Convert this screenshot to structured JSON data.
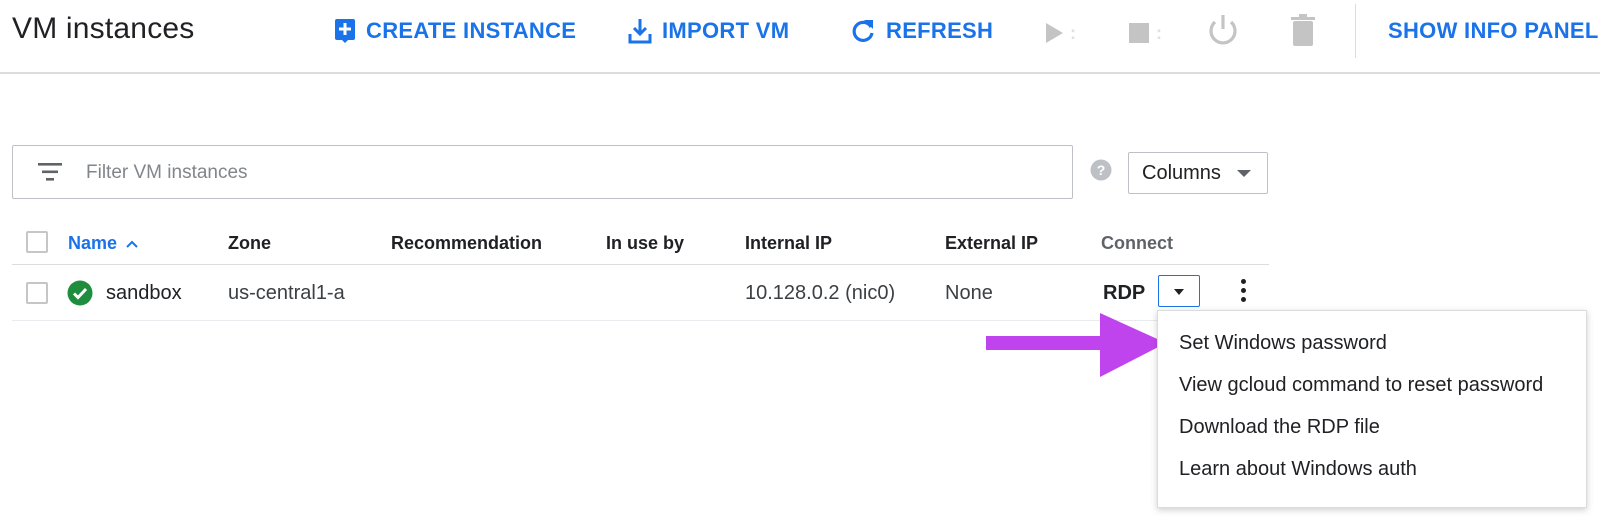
{
  "header": {
    "title": "VM instances",
    "create_instance": "CREATE INSTANCE",
    "import_vm": "IMPORT VM",
    "refresh": "REFRESH",
    "show_info_panel": "SHOW INFO PANEL"
  },
  "filter": {
    "placeholder": "Filter VM instances",
    "columns_label": "Columns"
  },
  "table": {
    "headers": {
      "name": "Name",
      "zone": "Zone",
      "recommendation": "Recommendation",
      "in_use_by": "In use by",
      "internal_ip": "Internal IP",
      "external_ip": "External IP",
      "connect": "Connect"
    },
    "rows": [
      {
        "name": "sandbox",
        "zone": "us-central1-a",
        "recommendation": "",
        "in_use_by": "",
        "internal_ip": "10.128.0.2 (nic0)",
        "external_ip": "None",
        "connect": "RDP",
        "status": "running"
      }
    ]
  },
  "connect_menu": {
    "items": [
      "Set Windows password",
      "View gcloud command to reset password",
      "Download the RDP file",
      "Learn about Windows auth"
    ]
  },
  "colors": {
    "accent": "#1a73e8",
    "success": "#1e8e3e",
    "annotation_arrow": "#c044ee",
    "disabled": "#c4c4c4"
  },
  "icons": {
    "create": "add-box-icon",
    "import": "download-icon",
    "refresh": "refresh-icon",
    "start": "play-icon",
    "stop": "stop-icon",
    "reset": "power-icon",
    "delete": "trash-icon",
    "filter": "filter-icon",
    "help": "help-icon",
    "status": "check-circle-icon",
    "more": "more-vert-icon"
  }
}
